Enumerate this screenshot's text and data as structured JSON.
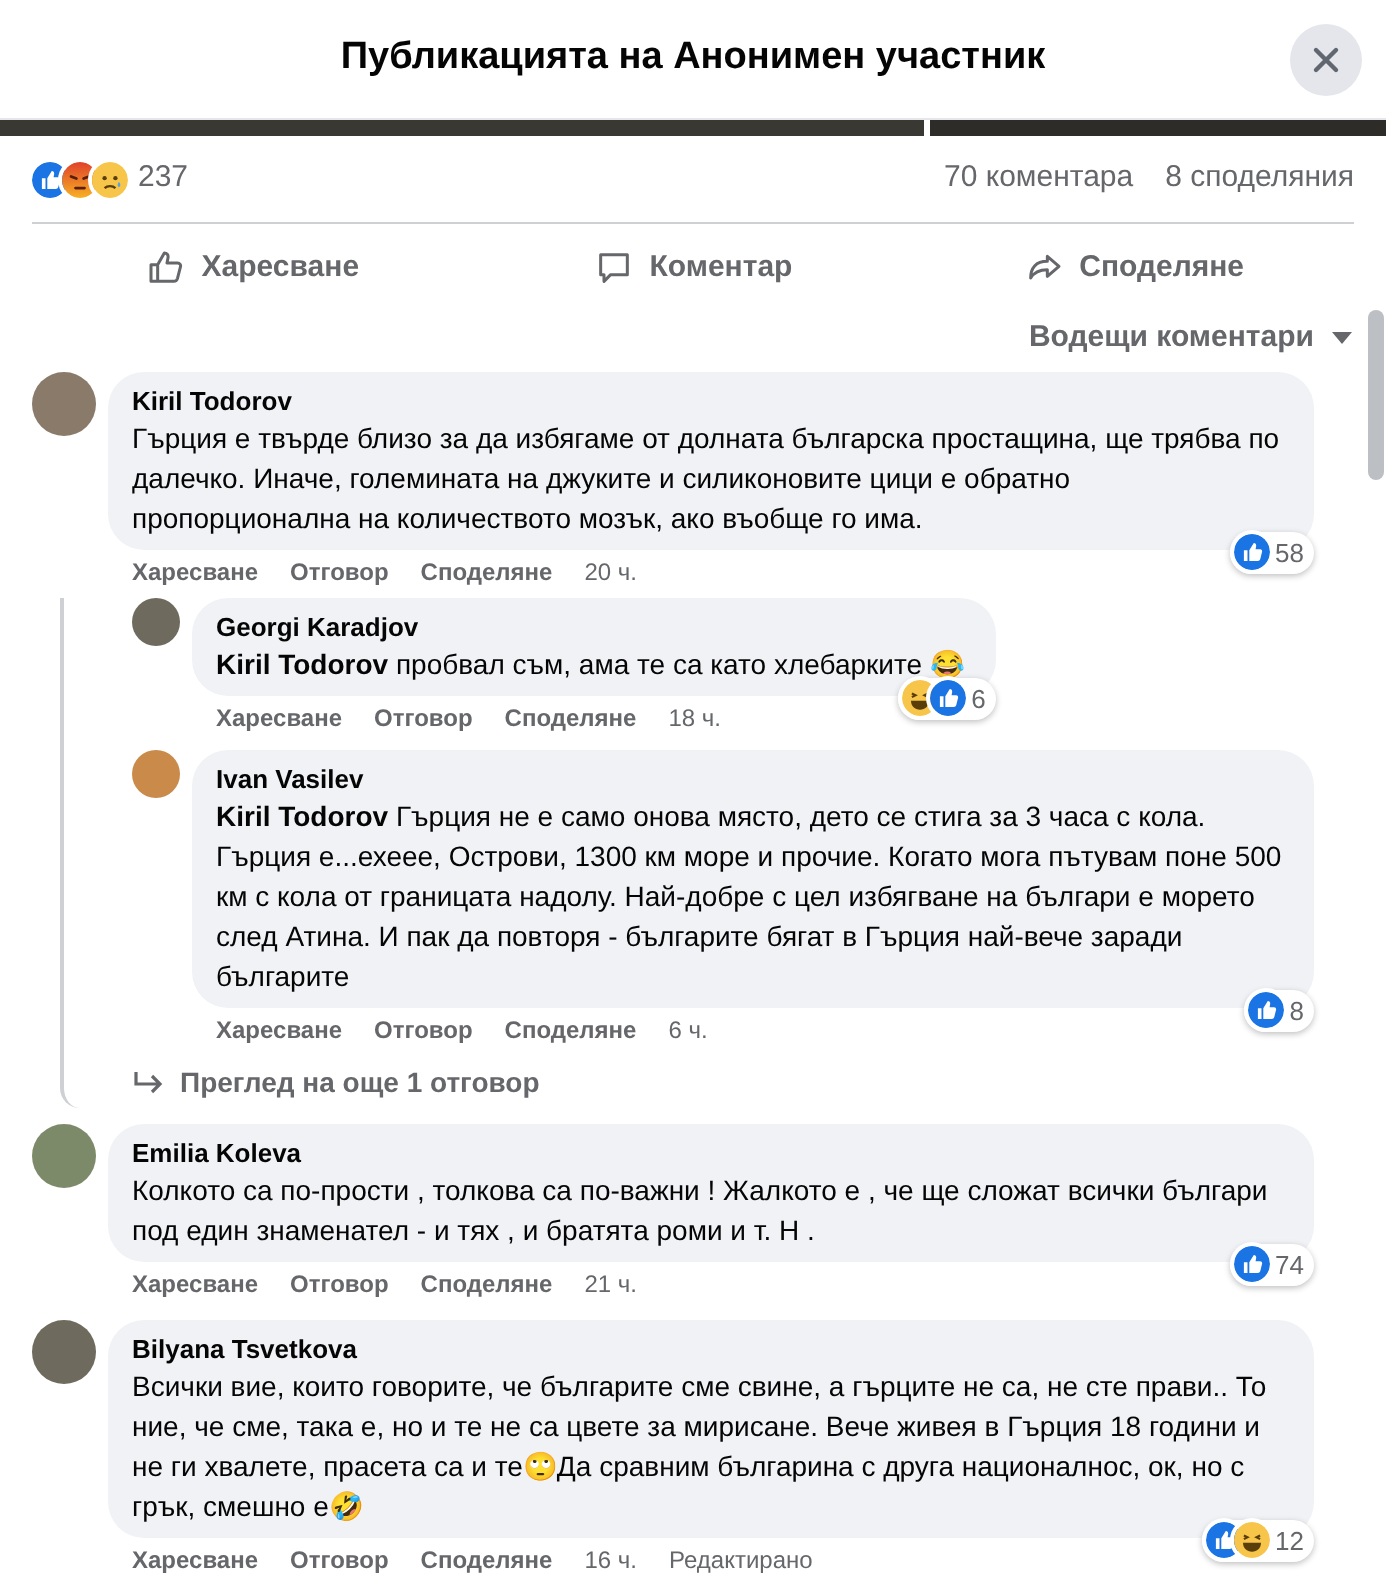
{
  "header": {
    "title": "Публикацията на Анонимен участник"
  },
  "summary": {
    "reactions": [
      {
        "kind": "like"
      },
      {
        "kind": "angry"
      },
      {
        "kind": "sad"
      }
    ],
    "count": "237",
    "comments": "70 коментара",
    "shares": "8 споделяния"
  },
  "actions": [
    {
      "kind": "like",
      "label": "Харесване"
    },
    {
      "kind": "comment",
      "label": "Коментар"
    },
    {
      "kind": "share",
      "label": "Споделяне"
    }
  ],
  "sort": {
    "label": "Водещи коментари"
  },
  "comments": [
    {
      "author": "Kiril Todorov",
      "text": "Гърция е твърде близо за да избягаме от долната българска простащина, ще трябва по далечко. Иначе, големината на джуките и силиконовите цици е обратно пропорционална на количеството мозък, ако въобще го има.",
      "links": [
        "Харесване",
        "Отговор",
        "Споделяне"
      ],
      "time": "20 ч.",
      "reactions": {
        "kinds": [
          {
            "kind": "like"
          }
        ],
        "count": "58"
      },
      "children": [
        {
          "author": "Georgi Karadjov",
          "mention": "Kiril Todorov",
          "text": "пробвал съм, ама те са като хлебарките 😂",
          "links": [
            "Харесване",
            "Отговор",
            "Споделяне"
          ],
          "time": "18 ч.",
          "reactions": {
            "kinds": [
              {
                "kind": "haha"
              },
              {
                "kind": "like"
              }
            ],
            "count": "6"
          }
        },
        {
          "author": "Ivan Vasilev",
          "mention": "Kiril Todorov",
          "text": "Гърция не е само онова място, дето се стига за 3 часа с кола. Гърция е...ехеее, Острови, 1300 км море и прочие. Когато мога пътувам поне 500 км с кола от границата надолу. Най-добре с цел избягване на българи е морето след Атина. И пак да повторя - българите бягат в Гърция най-вече заради българите",
          "links": [
            "Харесване",
            "Отговор",
            "Споделяне"
          ],
          "time": "6 ч.",
          "reactions": {
            "kinds": [
              {
                "kind": "like"
              }
            ],
            "count": "8"
          }
        }
      ],
      "more": "Преглед на още 1 отговор"
    },
    {
      "author": "Emilia Koleva",
      "text": "Колкото са по-прости , толкова са по-важни ! Жалкото е , че ще сложат всички българи под един знаменател - и тях , и братята роми и т. Н .",
      "links": [
        "Харесване",
        "Отговор",
        "Споделяне"
      ],
      "time": "21 ч.",
      "reactions": {
        "kinds": [
          {
            "kind": "like"
          }
        ],
        "count": "74"
      }
    },
    {
      "author": "Bilyana Tsvetkova",
      "text": "Всички вие, които говорите, че българите сме свине, а гърците не са, не сте прави.. То ние, че сме, така е, но и те не са цвете за мирисане. Вече живея в Гърция 18 години и не ги хвалете, прасета са и те🙄Да сравним българина с друга националнос, ок, но с грък, смешно е🤣",
      "links": [
        "Харесване",
        "Отговор",
        "Споделяне"
      ],
      "time": "16 ч.",
      "edited": "Редактирано",
      "reactions": {
        "kinds": [
          {
            "kind": "like"
          },
          {
            "kind": "haha"
          }
        ],
        "count": "12"
      }
    }
  ]
}
